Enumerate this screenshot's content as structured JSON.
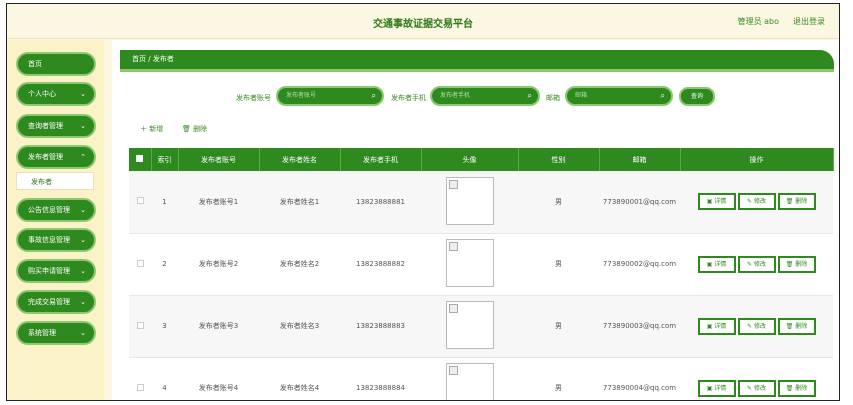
{
  "header": {
    "title": "交通事故证据交易平台",
    "admin": "管理员 abo",
    "logout": "退出登录"
  },
  "sidebar": {
    "items": [
      {
        "label": "首页",
        "chevron": false
      },
      {
        "label": "个人中心",
        "chevron": true
      },
      {
        "label": "查询者管理",
        "chevron": true
      },
      {
        "label": "发布者管理",
        "chevron": true
      },
      {
        "label": "公告信息管理",
        "chevron": true
      },
      {
        "label": "事故信息管理",
        "chevron": true
      },
      {
        "label": "购买申请管理",
        "chevron": true
      },
      {
        "label": "完成交易管理",
        "chevron": true
      },
      {
        "label": "系统管理",
        "chevron": true
      }
    ],
    "sub_item": "发布者"
  },
  "breadcrumb": {
    "home": "首页",
    "separator": "/",
    "current": "发布者"
  },
  "filters": {
    "account_label": "发布者账号",
    "account_placeholder": "发布者账号",
    "phone_label": "发布者手机",
    "phone_placeholder": "发布者手机",
    "email_label": "邮箱",
    "email_placeholder": "邮箱",
    "search_button": "查询"
  },
  "actions": {
    "add": "新增",
    "delete": "删除"
  },
  "table": {
    "headers": [
      "索引",
      "发布者账号",
      "发布者姓名",
      "发布者手机",
      "头像",
      "性别",
      "邮箱",
      "操作"
    ],
    "rows": [
      {
        "index": "1",
        "account": "发布者账号1",
        "name": "发布者姓名1",
        "phone": "13823888881",
        "gender": "男",
        "email": "773890001@qq.com"
      },
      {
        "index": "2",
        "account": "发布者账号2",
        "name": "发布者姓名2",
        "phone": "13823888882",
        "gender": "男",
        "email": "773890002@qq.com"
      },
      {
        "index": "3",
        "account": "发布者账号3",
        "name": "发布者姓名3",
        "phone": "13823888883",
        "gender": "男",
        "email": "773890003@qq.com"
      },
      {
        "index": "4",
        "account": "发布者账号4",
        "name": "发布者姓名4",
        "phone": "13823888884",
        "gender": "男",
        "email": "773890004@qq.com"
      }
    ],
    "op_detail": "详情",
    "op_edit": "修改",
    "op_delete": "删除"
  },
  "colors": {
    "primary": "#2e8a1f",
    "border": "#8cc870",
    "background": "#fbf7e2"
  }
}
